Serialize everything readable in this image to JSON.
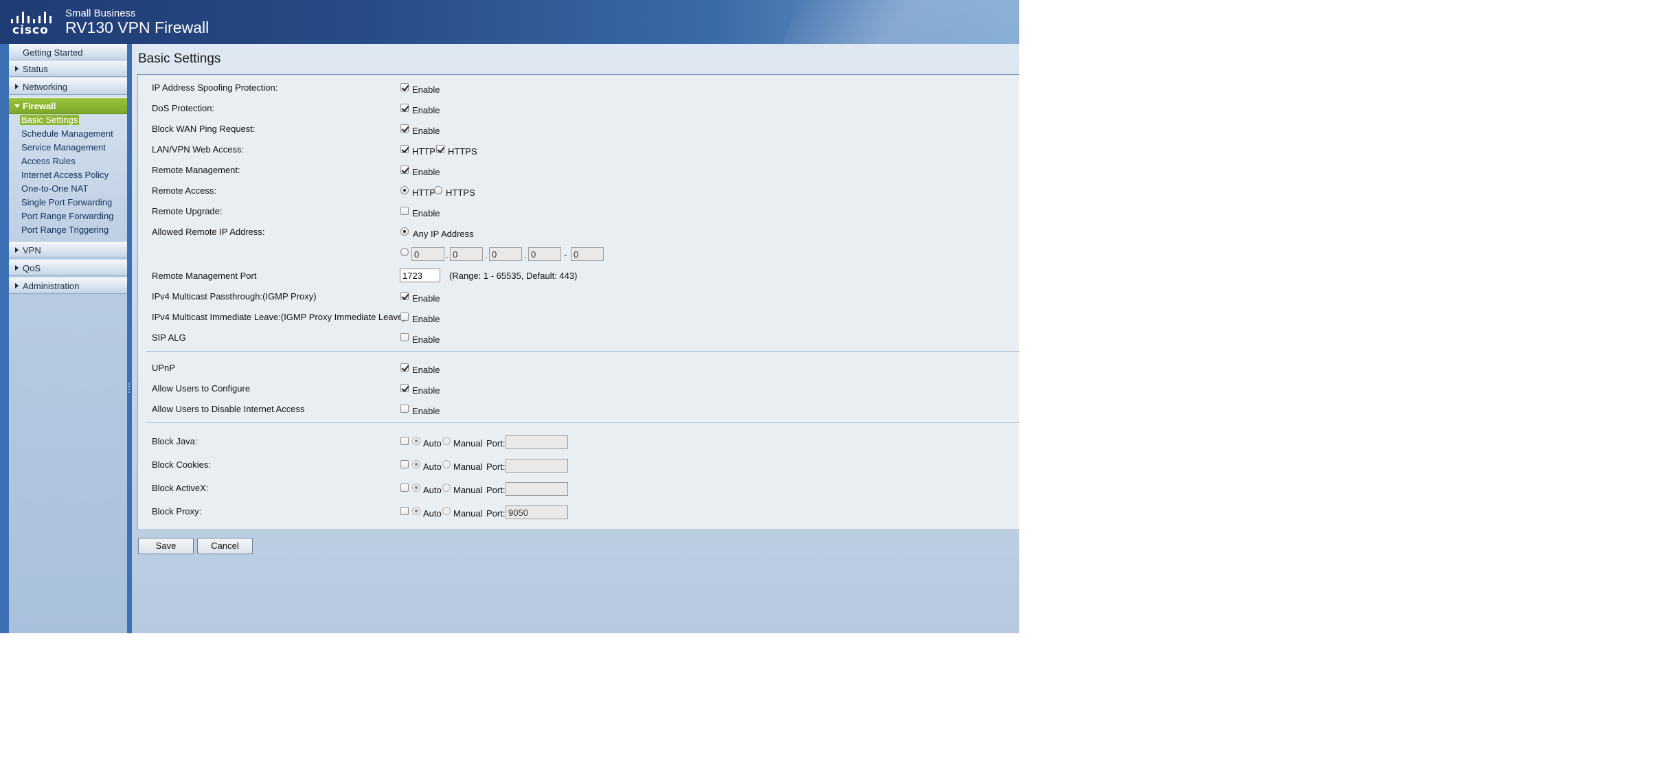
{
  "header": {
    "logo_text": "cisco",
    "brand_small": "Small Business",
    "product_title": "RV130 VPN Firewall"
  },
  "sidebar": {
    "items": [
      {
        "label": "Getting Started"
      },
      {
        "label": "Status"
      },
      {
        "label": "Networking"
      },
      {
        "label": "Firewall"
      },
      {
        "label": "VPN"
      },
      {
        "label": "QoS"
      },
      {
        "label": "Administration"
      }
    ],
    "firewall_sub": [
      {
        "label": "Basic Settings"
      },
      {
        "label": "Schedule Management"
      },
      {
        "label": "Service Management"
      },
      {
        "label": "Access Rules"
      },
      {
        "label": "Internet Access Policy"
      },
      {
        "label": "One-to-One NAT"
      },
      {
        "label": "Single Port Forwarding"
      },
      {
        "label": "Port Range Forwarding"
      },
      {
        "label": "Port Range Triggering"
      }
    ]
  },
  "main": {
    "title": "Basic Settings",
    "rows": {
      "ip_spoofing": {
        "label": "IP Address Spoofing Protection:",
        "option": "Enable",
        "checked": true
      },
      "dos": {
        "label": "DoS Protection:",
        "option": "Enable",
        "checked": true
      },
      "block_wan_ping": {
        "label": "Block WAN Ping Request:",
        "option": "Enable",
        "checked": true
      },
      "lan_vpn_web": {
        "label": "LAN/VPN Web Access:",
        "http": "HTTP",
        "https": "HTTPS",
        "http_checked": true,
        "https_checked": true
      },
      "remote_mgmt": {
        "label": "Remote Management:",
        "option": "Enable",
        "checked": true
      },
      "remote_access": {
        "label": "Remote Access:",
        "http": "HTTP",
        "https": "HTTPS",
        "selected": "HTTP"
      },
      "remote_upgrade": {
        "label": "Remote Upgrade:",
        "option": "Enable",
        "checked": false
      },
      "allowed_remote_ip": {
        "label": "Allowed Remote IP Address:",
        "any_option": "Any IP Address",
        "range_octets": [
          "0",
          "0",
          "0",
          "0"
        ],
        "dot": ".",
        "dash": "-",
        "range_end": "0"
      },
      "remote_mgmt_port": {
        "label": "Remote Management Port",
        "value": "1723",
        "hint": "(Range: 1 - 65535, Default: 443)"
      },
      "ipv4_multicast_passthrough": {
        "label": "IPv4 Multicast Passthrough:(IGMP Proxy)",
        "option": "Enable",
        "checked": true
      },
      "ipv4_multicast_leave": {
        "label": "IPv4 Multicast Immediate Leave:(IGMP Proxy Immediate Leave)",
        "option": "Enable",
        "checked": false
      },
      "sip_alg": {
        "label": "SIP ALG",
        "option": "Enable",
        "checked": false
      },
      "upnp": {
        "label": "UPnP",
        "option": "Enable",
        "checked": true
      },
      "allow_users_configure": {
        "label": "Allow Users to Configure",
        "option": "Enable",
        "checked": true
      },
      "allow_users_disable": {
        "label": "Allow Users to Disable Internet Access",
        "option": "Enable",
        "checked": false
      }
    },
    "block_items": [
      {
        "label": "Block Java:",
        "auto": "Auto",
        "manual": "Manual",
        "port_label": "Port:",
        "port": ""
      },
      {
        "label": "Block Cookies:",
        "auto": "Auto",
        "manual": "Manual",
        "port_label": "Port:",
        "port": ""
      },
      {
        "label": "Block ActiveX:",
        "auto": "Auto",
        "manual": "Manual",
        "port_label": "Port:",
        "port": ""
      },
      {
        "label": "Block Proxy:",
        "auto": "Auto",
        "manual": "Manual",
        "port_label": "Port:",
        "port": "9050"
      }
    ]
  },
  "buttons": {
    "save": "Save",
    "cancel": "Cancel"
  },
  "colors": {
    "header": "#274a86",
    "active_nav": "#8fb834",
    "content_bg": "#b6c9df"
  }
}
